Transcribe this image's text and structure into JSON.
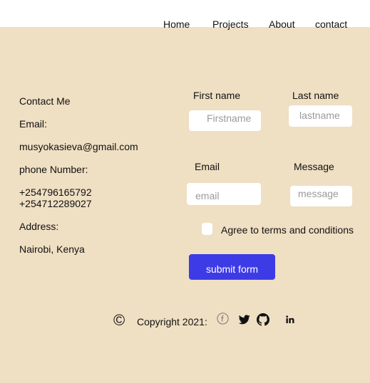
{
  "nav": {
    "home": "Home",
    "projects": "Projects",
    "about": "About",
    "contact": "contact"
  },
  "contact_info": {
    "heading": "Contact Me",
    "email_label": "Email:",
    "email": "musyokasieva@gmail.com",
    "phone_label": "phone Number:",
    "phone1": "+254796165792",
    "phone2": "+254712289027",
    "address_label": "Address:",
    "address": "Nairobi, Kenya"
  },
  "form": {
    "first_name_label": "First name",
    "first_name_placeholder": "Firstname",
    "last_name_label": "Last name",
    "last_name_placeholder": "lastname",
    "email_label": "Email",
    "email_placeholder": "email",
    "message_label": "Message",
    "message_placeholder": "message",
    "agree_label": "Agree to terms and conditions",
    "submit_label": "submit form"
  },
  "footer": {
    "copyright_symbol": "©",
    "copyright_text": "Copyright 2021:",
    "icons": [
      "facebook-icon",
      "twitter-icon",
      "github-icon",
      "linkedin-icon"
    ]
  },
  "colors": {
    "background": "#efdfc3",
    "button": "#3d3be6"
  }
}
